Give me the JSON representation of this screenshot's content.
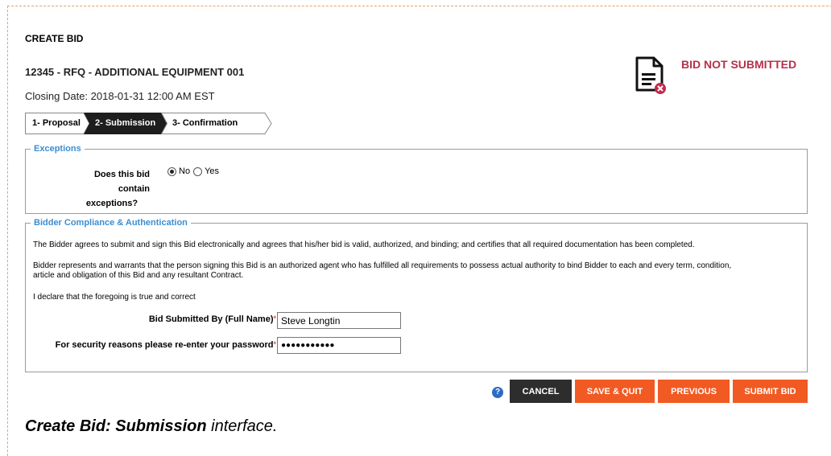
{
  "page": {
    "heading": "CREATE BID",
    "rfq_title": "12345 - RFQ - ADDITIONAL EQUIPMENT 001",
    "closing_date": "Closing Date: 2018-01-31 12:00 AM EST",
    "status": "BID NOT SUBMITTED",
    "status_icon": "document-error-icon"
  },
  "steps": [
    {
      "label": "1- Proposal",
      "active": false
    },
    {
      "label": "2- Submission",
      "active": true
    },
    {
      "label": "3- Confirmation",
      "active": false
    }
  ],
  "exceptions": {
    "legend": "Exceptions",
    "question_line1": "Does this bid contain",
    "question_line2": "exceptions?",
    "options": [
      {
        "label": "No",
        "selected": true
      },
      {
        "label": "Yes",
        "selected": false
      }
    ]
  },
  "compliance": {
    "legend": "Bidder Compliance & Authentication",
    "paragraph1": "The Bidder agrees to submit and sign this Bid electronically and agrees that his/her bid is valid, authorized, and binding; and certifies that all required documentation has been completed.",
    "paragraph2_line1": "Bidder represents and warrants that the person signing this Bid is an authorized agent who has fulfilled all requirements to possess actual authority to bind Bidder to each and every term, condition,",
    "paragraph2_line2": "article and obligation of this Bid and any resultant Contract.",
    "declaration": "I declare that the foregoing is true and correct",
    "name_label": "Bid Submitted By (Full Name)",
    "name_value": "Steve Longtin",
    "password_label": "For security reasons please re-enter your password",
    "password_value": "●●●●●●●●●●●",
    "required_mark": "*"
  },
  "actions": {
    "help": "?",
    "cancel": "CANCEL",
    "save_quit": "SAVE & QUIT",
    "previous": "PREVIOUS",
    "submit": "SUBMIT BID"
  },
  "caption": {
    "bold": "Create Bid: Submission",
    "rest": " interface."
  },
  "colors": {
    "accent_blue": "#3a8ed2",
    "status_red": "#b5314a",
    "button_orange": "#f15a22",
    "button_dark": "#2d2d2d"
  }
}
